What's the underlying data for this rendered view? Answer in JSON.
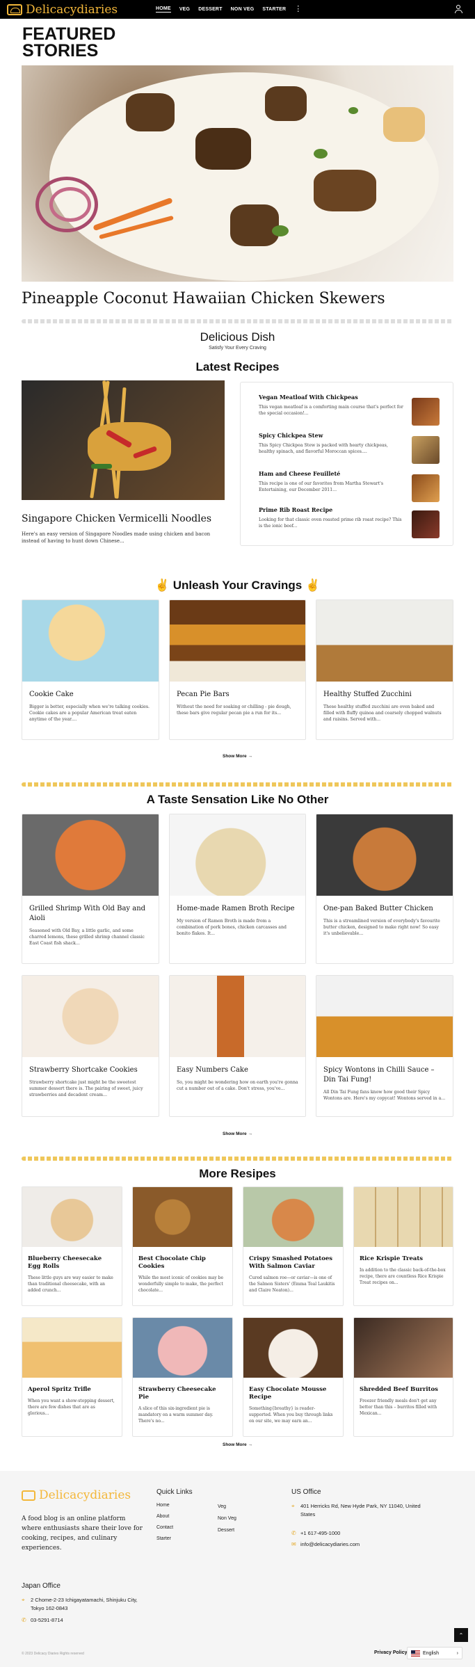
{
  "header": {
    "logo_text": "Delicacydiaries",
    "nav": [
      "HOME",
      "VEG",
      "DESSERT",
      "NON VEG",
      "STARTER"
    ],
    "more_icon": "kebab-menu-icon",
    "user_icon": "user-icon"
  },
  "featured": {
    "heading": "FEATURED STORIES",
    "title": "Pineapple Coconut Hawaiian Chicken Skewers"
  },
  "tagline": {
    "title": "Delicious Dish",
    "subtitle": "Satisfy Your Every Craving"
  },
  "latest": {
    "heading": "Latest Recipes",
    "main": {
      "title": "Singapore Chicken Vermicelli Noodles",
      "desc": "Here's an easy version of Singapore Noodles made using chicken and bacon instead of having to hunt down Chinese..."
    },
    "items": [
      {
        "title": "Vegan Meatloaf With Chickpeas",
        "desc": "This vegan meatloaf is a comforting main course that's perfect for the special occasion!..."
      },
      {
        "title": "Spicy Chickpea Stew",
        "desc": "This Spicy Chickpea Stew is packed with hearty chickpeas, healthy spinach, and flavorful Moroccan spices...."
      },
      {
        "title": "Ham and Cheese Feuilleté",
        "desc": "This recipe is one of our favorites from Martha Stewart's Entertaining, our December 2011..."
      },
      {
        "title": "Prime Rib Roast Recipe",
        "desc": "Looking for that classic oven roasted prime rib roast recipe? This is the ionic beef..."
      }
    ]
  },
  "cravings": {
    "heading": "Unleash Your Cravings",
    "cards": [
      {
        "title": "Cookie Cake",
        "desc": "Bigger is better, especially when we're talking cookies. Cookie cakes are a popular American treat eaten anytime of the year...."
      },
      {
        "title": "Pecan Pie Bars",
        "desc": "Without the need for soaking or chilling - pie dough, these bars give regular pecan pie a run for its..."
      },
      {
        "title": "Healthy Stuffed Zucchini",
        "desc": "These healthy stuffed zucchini are oven baked and filled with fluffy quinoa and coarsely chopped walnuts and raisins. Served with..."
      }
    ],
    "show_more": "Show More →"
  },
  "sensation": {
    "heading": "A Taste Sensation Like No Other",
    "cards": [
      {
        "title": "Grilled Shrimp With Old Bay and Aioli",
        "desc": "Seasoned with Old Bay, a little garlic, and some charred lemons, these grilled shrimp channel classic East Coast fish shack..."
      },
      {
        "title": "Home-made Ramen Broth Recipe",
        "desc": "My version of Ramen Broth is made from a combination of pork bones, chicken carcasses and bonito flakes. It..."
      },
      {
        "title": "One-pan Baked Butter Chicken",
        "desc": "This is a streamlined version of everybody's favourite butter chicken, designed to make right now! So easy it's unbelievable..."
      },
      {
        "title": "Strawberry Shortcake Cookies",
        "desc": "Strawberry shortcake just might be the sweetest summer dessert there is. The pairing of sweet, juicy strawberries and decadent cream..."
      },
      {
        "title": "Easy Numbers Cake",
        "desc": "So, you might be wondering how on earth you're gonna cut a number out of a cake. Don't stress, you've..."
      },
      {
        "title": "Spicy Wontons in Chilli Sauce – Din Tai Fung!",
        "desc": "All Din Tai Fung fans know how good their Spicy Wontons are. Here's my copycat! Wontons served in a..."
      }
    ],
    "show_more": "Show More →"
  },
  "more": {
    "heading": "More Resipes",
    "cards": [
      {
        "title": "Blueberry Cheesecake Egg Rolls",
        "desc": "These little guys are way easier to make than traditional cheesecake, with an added crunch..."
      },
      {
        "title": "Best Chocolate Chip Cookies",
        "desc": "While the most iconic of cookies may be wonderfully simple to make, the perfect chocolate..."
      },
      {
        "title": "Crispy Smashed Potatoes With Salmon Caviar",
        "desc": "Cured salmon roe—or caviar—is one of the Salmon Sisters' (Emma Teal Laukitis and Claire Neaton)..."
      },
      {
        "title": "Rice Krispie Treats",
        "desc": "In addition to the classic back-of-the-box recipe, there are countless Rice Krispie Treat recipes on..."
      },
      {
        "title": "Aperol Spritz Trifle",
        "desc": "When you want a show-stopping dessert, there are few dishes that are as glorious..."
      },
      {
        "title": "Strawberry Cheesecake Pie",
        "desc": "A slice of this six-ingredient pie is mandatory on a warm summer day. There's no..."
      },
      {
        "title": "Easy Chocolate Mousse Recipe",
        "desc": "Something{breathy} is reader-supported. When you buy through links on our site, we may earn an..."
      },
      {
        "title": "Shredded Beef Burritos",
        "desc": "Freezer friendly meals don't get any better than this – burritos filled with Mexican..."
      }
    ],
    "show_more": "Show More →"
  },
  "footer": {
    "logo_text": "Delicacydiaries",
    "about": "A food blog is an online platform where enthusiasts share their love for cooking, recipes, and culinary experiences.",
    "quick_links_title": "Quick Links",
    "links_col1": [
      "Home",
      "About",
      "Contact",
      "Starter"
    ],
    "links_col2": [
      "Veg",
      "Non Veg",
      "Dessert"
    ],
    "us_office_title": "US Office",
    "us_address": "401 Herricks Rd, New Hyde Park, NY 11040, United States",
    "us_phone": "+1 617-495-1000",
    "us_email": "info@delicacydiaries.com",
    "japan_office_title": "Japan Office",
    "japan_address": "2 Chome-2-23 Ichigayatamachi, Shinjuku City, Tokyo 162-0843",
    "japan_phone": "03-5291-8714",
    "copyright": "© 2023 Delicacy Diaries Rights reserved",
    "privacy": "Privacy Policy",
    "language": "English"
  }
}
